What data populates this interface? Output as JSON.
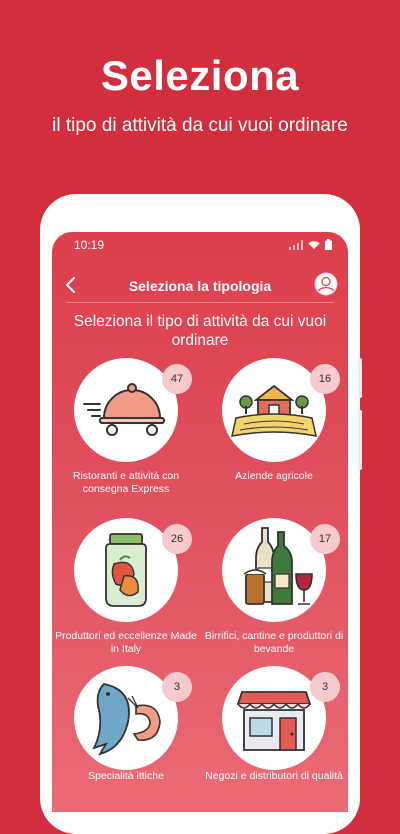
{
  "promo": {
    "headline": "Seleziona",
    "subline": "il tipo di attività da cui vuoi ordinare"
  },
  "status_bar": {
    "time": "10:19"
  },
  "app_bar": {
    "title": "Seleziona la tipologia"
  },
  "prompt": "Seleziona il tipo di attività da cui vuoi ordinare",
  "categories": [
    {
      "label": "Ristoranti e attività con consegna Express",
      "count": "47",
      "icon": "cloche-delivery-icon"
    },
    {
      "label": "Aziende agricole",
      "count": "16",
      "icon": "farm-icon"
    },
    {
      "label": "Produttori ed eccellenze Made in Italy",
      "count": "26",
      "icon": "jar-peppers-icon"
    },
    {
      "label": "Birrifici, cantine e produttori di bevande",
      "count": "17",
      "icon": "beverages-icon"
    },
    {
      "label": "Specialità ittiche",
      "count": "3",
      "icon": "fish-shrimp-icon"
    },
    {
      "label": "Negozi e distributori di qualità",
      "count": "3",
      "icon": "shop-icon"
    }
  ],
  "colors": {
    "background": "#d12f3e",
    "badge": "#f6c9cd",
    "screen_gradient_top": "#dd3f4d",
    "screen_gradient_bottom": "#ea6b76"
  }
}
